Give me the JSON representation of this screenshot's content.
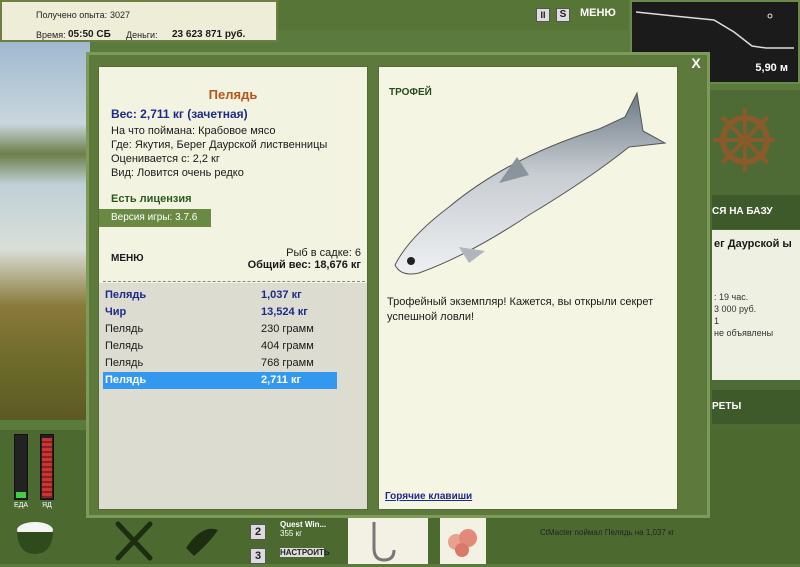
{
  "stats": {
    "exp_label": "Получено опыта:",
    "exp_value": "3027",
    "time_label": "Время:",
    "time_value": "05:50 СБ",
    "money_label": "Деньги:",
    "money_value": "23 623 871 руб."
  },
  "toolbar": {
    "pause_label": "II",
    "s_label": "S",
    "menu_label": "МЕНЮ"
  },
  "depth": {
    "value": "5,90 м"
  },
  "modal": {
    "close_label": "X",
    "fish": {
      "name": "Пелядь",
      "weight": "Вес: 2,711 кг (зачетная)",
      "bait": "На что поймана: Крабовое мясо",
      "place": "Где: Якутия, Берег Даурской лиственницы",
      "price": "Оценивается с: 2,2 кг",
      "kind": "Вид: Ловится очень редко"
    },
    "license": "Есть лицензия",
    "version": "Версия игры: 3.7.6",
    "menu_label": "МЕНЮ",
    "cage_count": "Рыб в садке: 6",
    "cage_weight": "Общий вес: 18,676 кг",
    "catch_list": [
      {
        "name": "Пелядь",
        "weight": "1,037 кг",
        "style": "bold"
      },
      {
        "name": "Чир",
        "weight": "13,524 кг",
        "style": "bold"
      },
      {
        "name": "Пелядь",
        "weight": "230 грамм",
        "style": "normal"
      },
      {
        "name": "Пелядь",
        "weight": "404 грамм",
        "style": "normal"
      },
      {
        "name": "Пелядь",
        "weight": "768 грамм",
        "style": "normal"
      },
      {
        "name": "Пелядь",
        "weight": "2,711 кг",
        "style": "selected"
      }
    ],
    "trophy_title": "ТРОФЕЙ",
    "trophy_text": "Трофейный экземпляр! Кажется, вы открыли секрет успешной ловли!",
    "hotkeys_label": "Горячие клавиши"
  },
  "background": {
    "right_header": "СЯ НА БАЗУ",
    "right_location": "ег Даурской ы",
    "right_info_1": ": 19 час.",
    "right_info_2": "3 000 руб.",
    "right_info_3": "1",
    "right_info_4": "не объявлены",
    "right_header2": "РЕТЫ",
    "chat_line": "CtMacter поймал Пелядь на 1,037 кг",
    "quest_name": "Quest Win...",
    "quest_weight": "355 кг",
    "quest_setup": "НАСТРОИТЬ",
    "slot_2": "2",
    "slot_3": "3",
    "eat_label": "ЕДА",
    "poison_label": "ЯД"
  }
}
